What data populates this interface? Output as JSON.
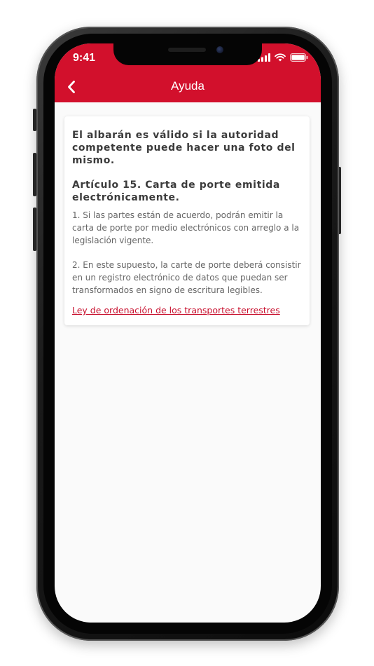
{
  "status_bar": {
    "time": "9:41"
  },
  "header": {
    "title": "Ayuda",
    "back_icon": "chevron-left-icon"
  },
  "card": {
    "heading": "El albarán es válido si la autoridad competente puede hacer una foto del mismo.",
    "article_title": "Artículo 15. Carta de porte emitida electrónicamente.",
    "paragraph_1": "1. Si las partes están de acuerdo, podrán emitir la carta de porte por medio electrónicos con arreglo a la legislación vigente.",
    "paragraph_2": "2. En este supuesto, la carte de porte deberá consistir en un registro electrónico de datos que puedan ser transformados en signo de escritura legibles.",
    "link_text": "Ley de ordenación de los transportes terrestres"
  },
  "colors": {
    "header_red": "#d2102c",
    "link_red": "#c8102e",
    "background": "#fafafa"
  }
}
